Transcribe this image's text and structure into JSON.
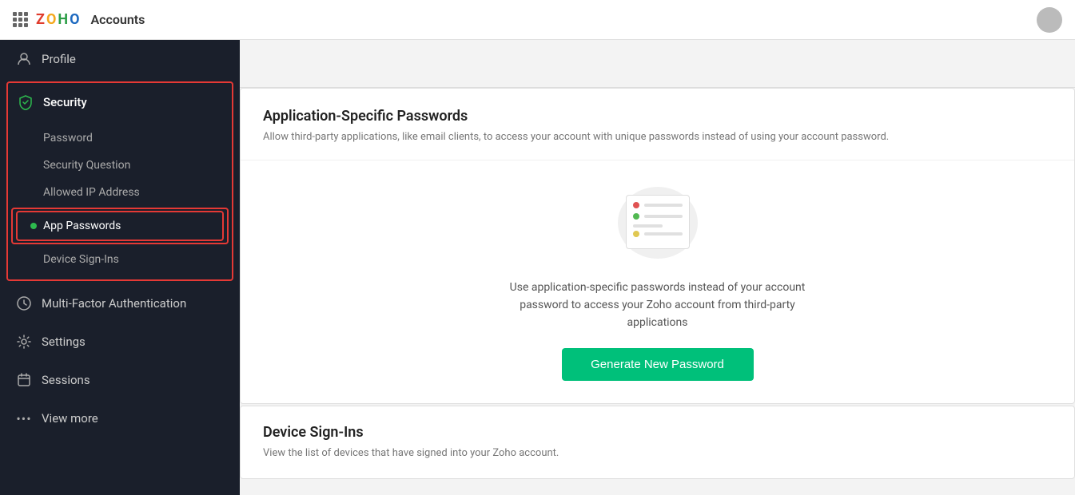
{
  "topnav": {
    "app_name": "Accounts",
    "avatar_alt": "User Avatar"
  },
  "sidebar": {
    "profile_label": "Profile",
    "security_label": "Security",
    "security_subitems": {
      "password": "Password",
      "security_question": "Security Question",
      "allowed_ip": "Allowed IP Address",
      "app_passwords": "App Passwords",
      "device_signins": "Device Sign-Ins"
    },
    "mfa_label": "Multi-Factor Authentication",
    "settings_label": "Settings",
    "sessions_label": "Sessions",
    "view_more_label": "View more"
  },
  "main": {
    "app_passwords_card": {
      "title": "Application-Specific Passwords",
      "subtitle": "Allow third-party applications, like email clients, to access your account with unique passwords instead of using your account password.",
      "description": "Use application-specific passwords instead of your account password to access your Zoho account from third-party applications",
      "generate_btn": "Generate New Password"
    },
    "device_signins_card": {
      "title": "Device Sign-Ins",
      "subtitle": "View the list of devices that have signed into your Zoho account."
    }
  },
  "icons": {
    "grid": "⊞",
    "profile": "👤",
    "shield": "🛡",
    "settings": "⚙",
    "sessions": "📅",
    "more": "•••",
    "active_dot_color": "#2dba4e",
    "red_border_color": "#e53935",
    "green_btn_color": "#00c07a"
  }
}
